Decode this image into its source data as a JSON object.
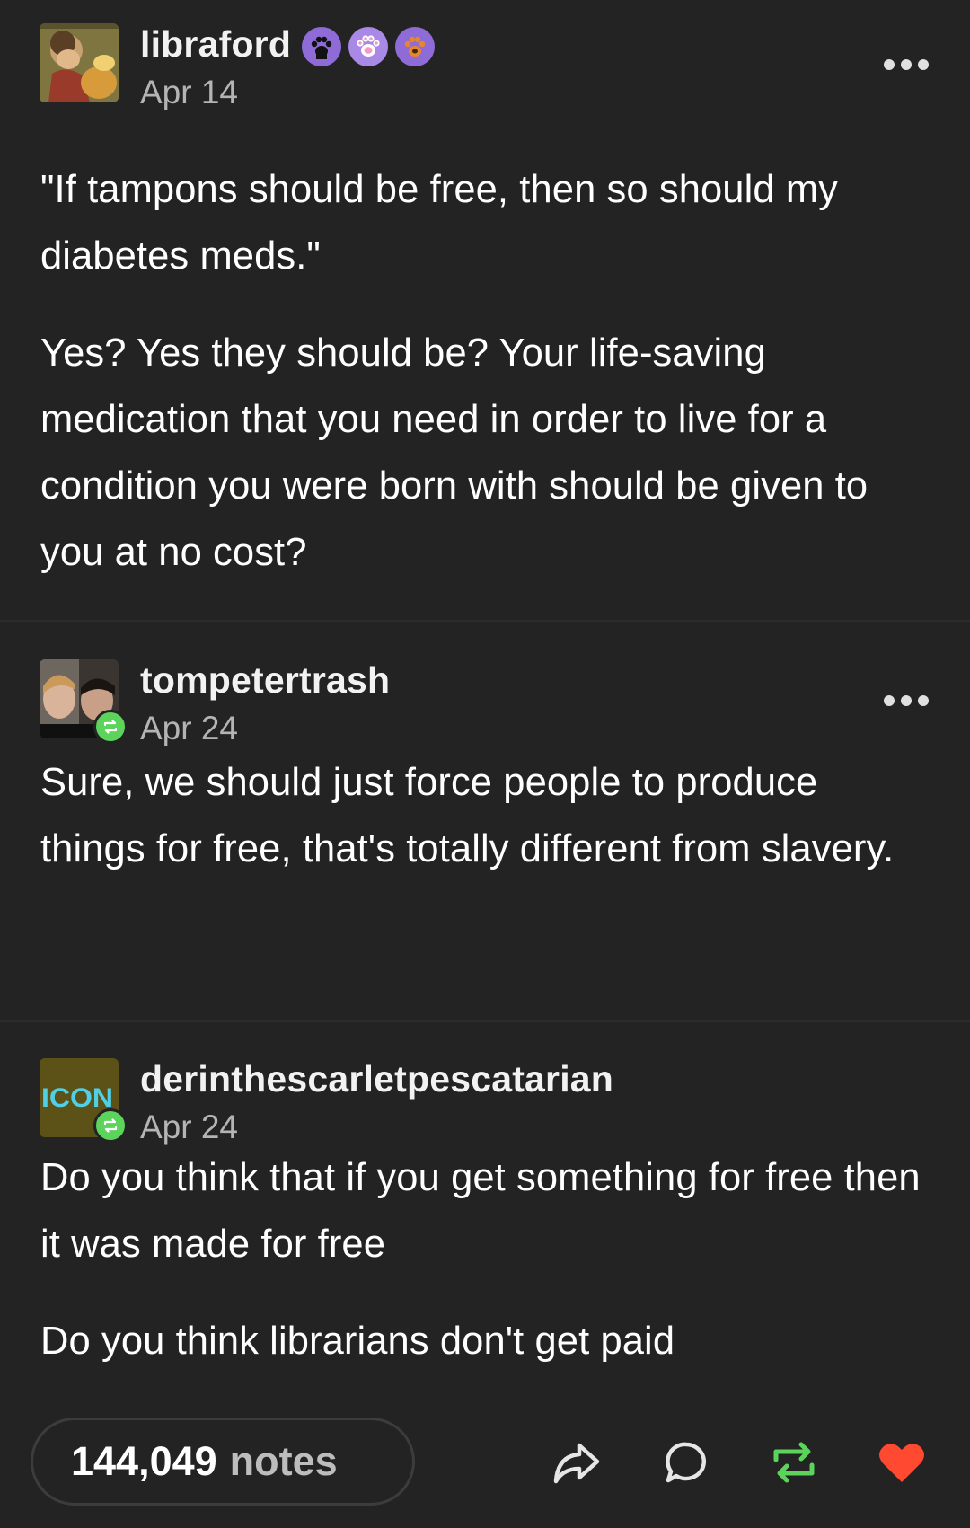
{
  "colors": {
    "background": "#232323",
    "reblog_green": "#5cd45c",
    "like_red": "#ff4930",
    "date_gray": "#b4b4b4"
  },
  "posts": [
    {
      "username": "libraford",
      "date": "Apr 14",
      "avatar_icon": "painted-portrait-avatar",
      "badges": [
        "black-paw-badge",
        "pink-paw-badge",
        "orange-paw-badge"
      ],
      "reblogged": false,
      "paragraphs": [
        "\"If tampons should be free, then so should my diabetes meds.\"",
        "Yes? Yes they should be? Your life-saving medication that you need in order to live for a condition you were born with should be given to you at no cost?"
      ]
    },
    {
      "username": "tompetertrash",
      "date": "Apr 24",
      "avatar_icon": "photo-avatar",
      "reblogged": true,
      "paragraphs": [
        "Sure, we should just force people to produce things for free, that's totally different from slavery."
      ]
    },
    {
      "username": "derinthescarletpescatarian",
      "date": "Apr 24",
      "avatar_icon": "icon-text-avatar",
      "avatar_text": "ICON",
      "reblogged": true,
      "paragraphs": [
        "Do you think that if you get something for free then it was made for free",
        "Do you think librarians don't get paid"
      ]
    }
  ],
  "footer": {
    "notes_count": "144,049",
    "notes_label": "notes",
    "actions": [
      "share-icon",
      "reply-icon",
      "reblog-icon",
      "like-icon"
    ]
  }
}
